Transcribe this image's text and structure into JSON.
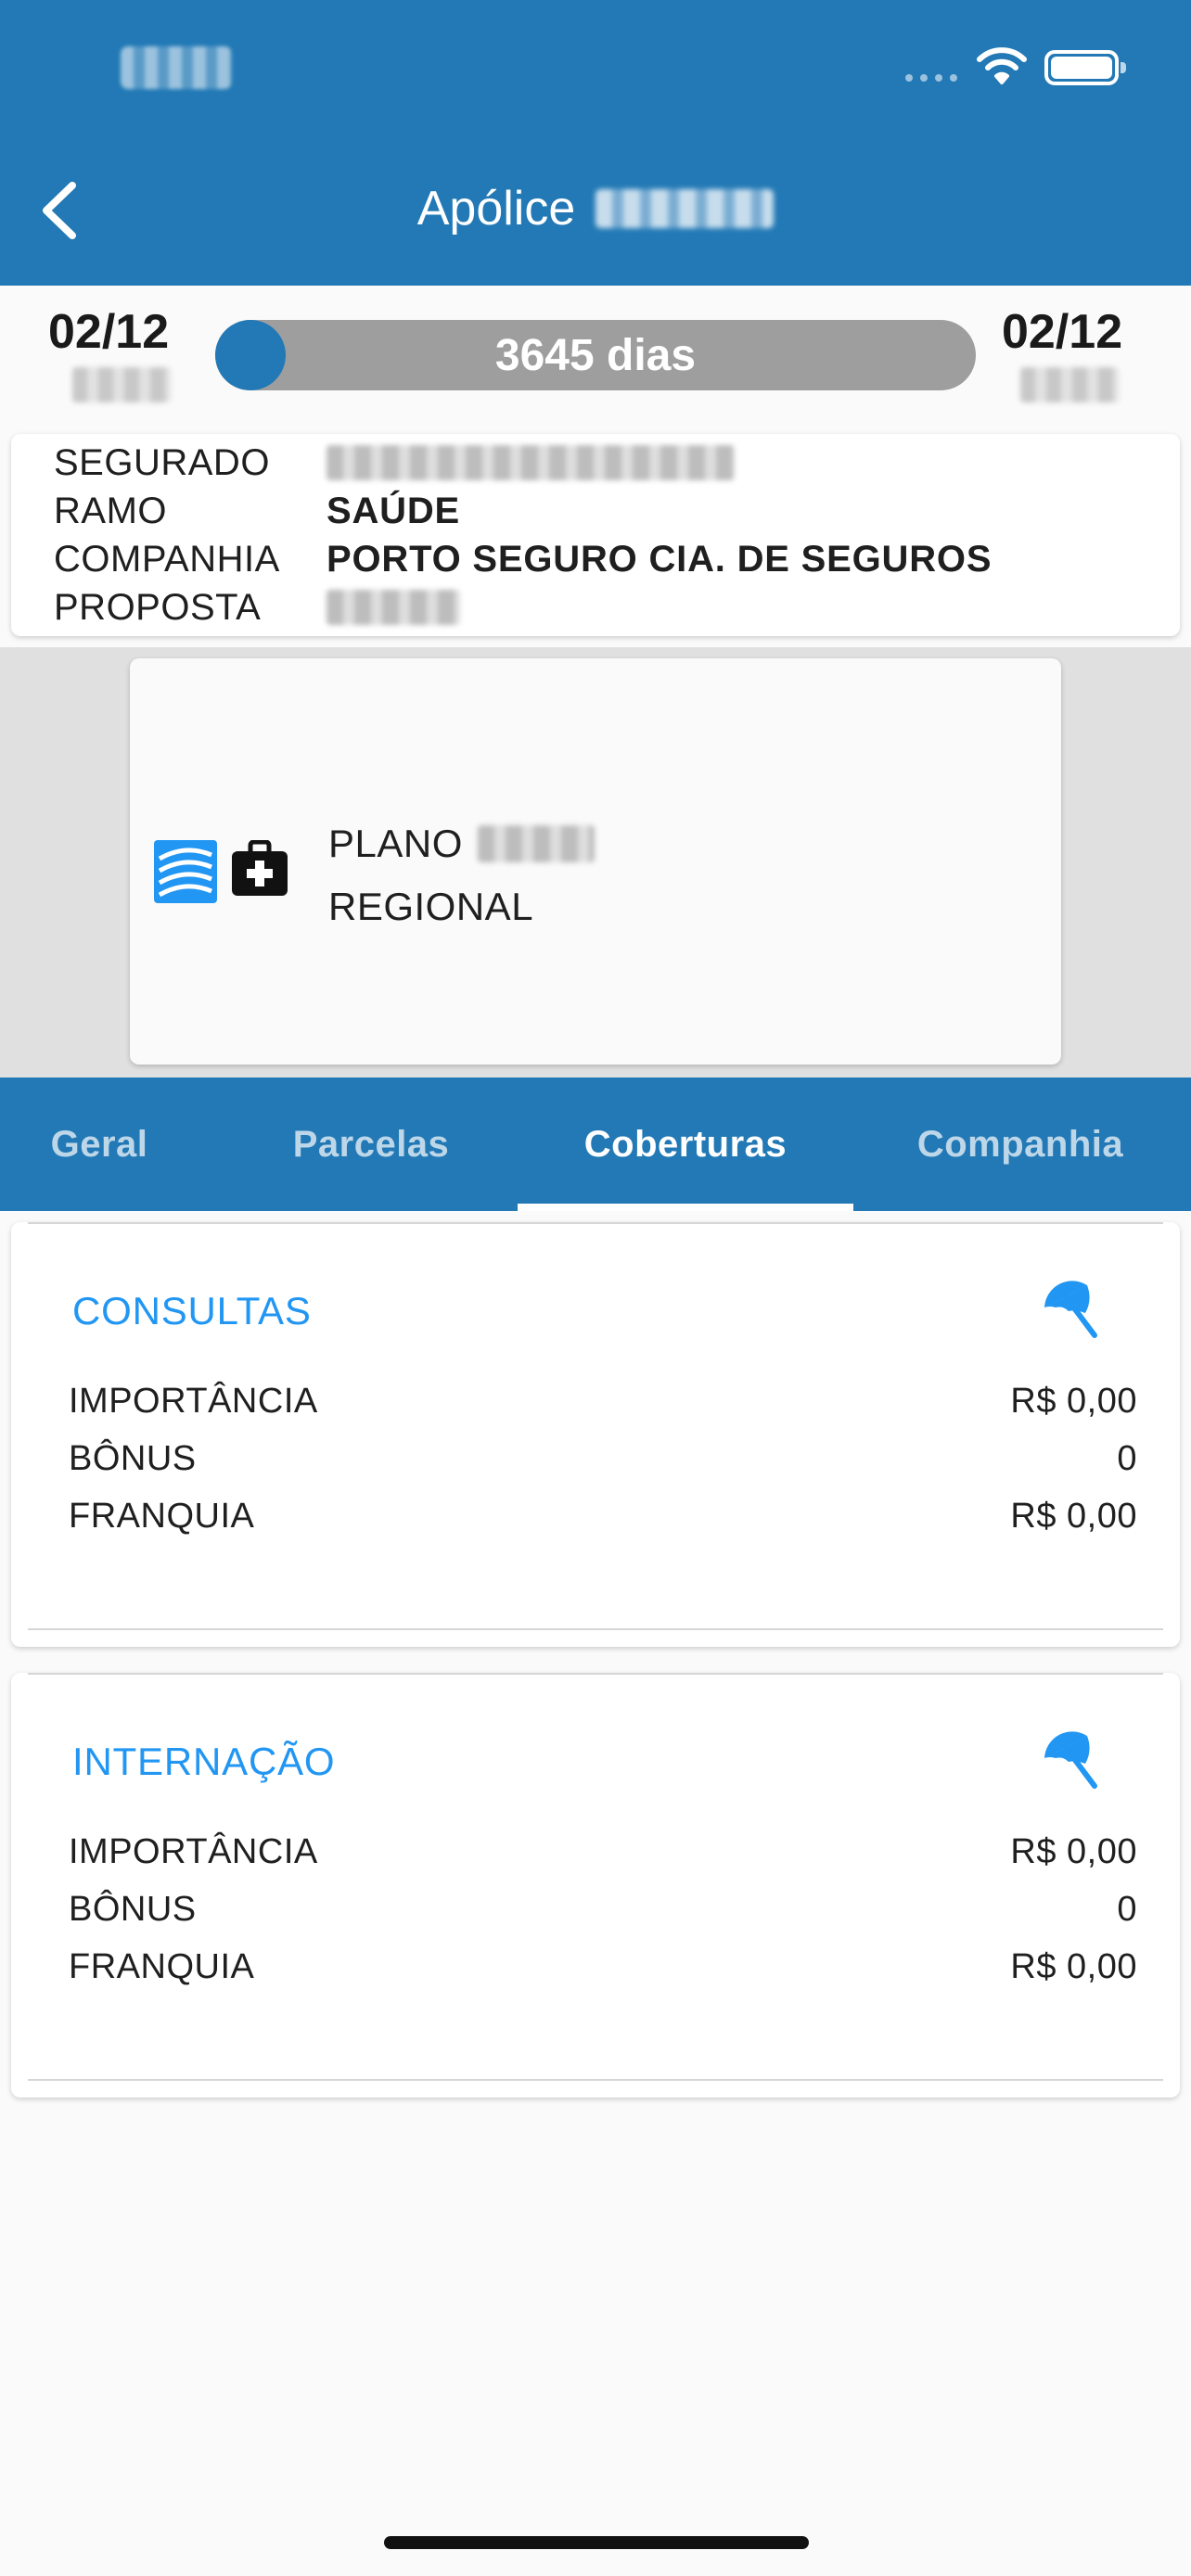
{
  "header": {
    "title": "Apólice"
  },
  "timeline": {
    "start_date": "02/12",
    "end_date": "02/12",
    "duration_label": "3645 dias"
  },
  "info": {
    "rows": [
      {
        "label": "SEGURADO",
        "value": ""
      },
      {
        "label": "RAMO",
        "value": "SAÚDE"
      },
      {
        "label": "COMPANHIA",
        "value": "PORTO SEGURO CIA. DE SEGUROS"
      },
      {
        "label": "PROPOSTA",
        "value": ""
      }
    ]
  },
  "plan": {
    "name": "PLANO",
    "region": "REGIONAL",
    "icons": [
      "porto-seguro-logo-icon",
      "medical-kit-icon"
    ]
  },
  "tabs": [
    {
      "label": "Geral",
      "active": false
    },
    {
      "label": "Parcelas",
      "active": false
    },
    {
      "label": "Coberturas",
      "active": true
    },
    {
      "label": "Companhia",
      "active": false
    }
  ],
  "coverages": [
    {
      "title": "CONSULTAS",
      "icon": "umbrella-icon",
      "rows": [
        {
          "label": "IMPORTÂNCIA",
          "value": "R$ 0,00"
        },
        {
          "label": "BÔNUS",
          "value": "0"
        },
        {
          "label": "FRANQUIA",
          "value": "R$ 0,00"
        }
      ]
    },
    {
      "title": "INTERNAÇÃO",
      "icon": "umbrella-icon",
      "rows": [
        {
          "label": "IMPORTÂNCIA",
          "value": "R$ 0,00"
        },
        {
          "label": "BÔNUS",
          "value": "0"
        },
        {
          "label": "FRANQUIA",
          "value": "R$ 0,00"
        }
      ]
    }
  ],
  "colors": {
    "primary": "#2279b5",
    "accent": "#2196f3",
    "progress_track": "#9e9e9e"
  }
}
